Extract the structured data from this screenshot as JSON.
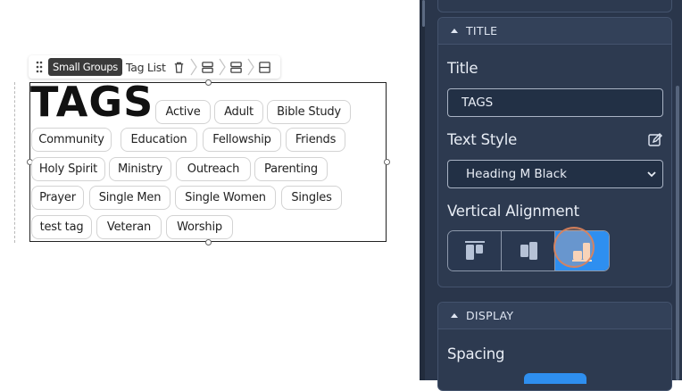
{
  "toolbar": {
    "block_type": "Small Groups",
    "block_name": "Tag List",
    "icons": [
      "drag-handle-icon",
      "trash-icon",
      "layout-top-icon",
      "layout-middle-icon",
      "layout-bottom-icon"
    ]
  },
  "block": {
    "heading": "TAGS",
    "tags": [
      "Active",
      "Adult",
      "Bible Study",
      "Community",
      "Education",
      "Fellowship",
      "Friends",
      "Holy Spirit",
      "Ministry",
      "Outreach",
      "Parenting",
      "Prayer",
      "Single Men",
      "Single Women",
      "Singles",
      "test tag",
      "Veteran",
      "Worship"
    ]
  },
  "panel": {
    "title_section": {
      "header": "TITLE",
      "title_label": "Title",
      "title_value": "TAGS",
      "text_style_label": "Text Style",
      "text_style_value": "Heading M Black",
      "vertical_alignment_label": "Vertical Alignment",
      "alignment_options": [
        "top",
        "middle",
        "bottom"
      ],
      "alignment_selected": "bottom"
    },
    "display_section": {
      "header": "DISPLAY",
      "spacing_label": "Spacing"
    }
  },
  "colors": {
    "panel_bg": "#2a364b",
    "accent": "#2e8ff0",
    "text_light": "#e8edf5"
  }
}
